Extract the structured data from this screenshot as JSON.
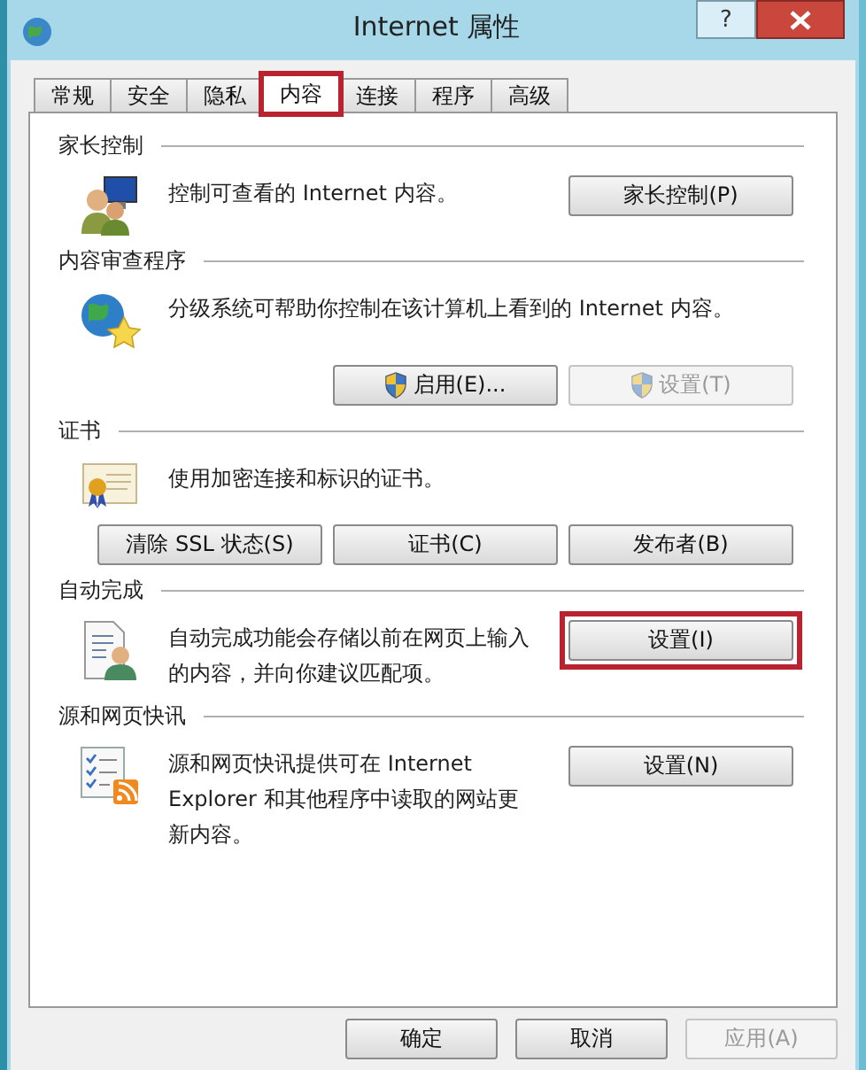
{
  "window": {
    "title": "Internet 属性",
    "help": "?"
  },
  "tabs": [
    {
      "label": "常规",
      "selected": false,
      "highlighted": false
    },
    {
      "label": "安全",
      "selected": false,
      "highlighted": false
    },
    {
      "label": "隐私",
      "selected": false,
      "highlighted": false
    },
    {
      "label": "内容",
      "selected": true,
      "highlighted": true
    },
    {
      "label": "连接",
      "selected": false,
      "highlighted": false
    },
    {
      "label": "程序",
      "selected": false,
      "highlighted": false
    },
    {
      "label": "高级",
      "selected": false,
      "highlighted": false
    }
  ],
  "sections": [
    {
      "title": "家长控制",
      "kind": "side",
      "description": "控制可查看的 Internet 内容。",
      "buttons": [
        {
          "label": "家长控制(P)",
          "disabled": false,
          "shield": false,
          "highlighted": false
        }
      ]
    },
    {
      "title": "内容审查程序",
      "kind": "below",
      "description": "分级系统可帮助你控制在该计算机上看到的 Internet 内容。",
      "buttons": [
        {
          "label": "启用(E)...",
          "disabled": false,
          "shield": true,
          "highlighted": false
        },
        {
          "label": "设置(T)",
          "disabled": true,
          "shield": true,
          "highlighted": false
        }
      ]
    },
    {
      "title": "证书",
      "kind": "below",
      "description": "使用加密连接和标识的证书。",
      "buttons": [
        {
          "label": "清除 SSL 状态(S)",
          "disabled": false,
          "shield": false,
          "highlighted": false
        },
        {
          "label": "证书(C)",
          "disabled": false,
          "shield": false,
          "highlighted": false
        },
        {
          "label": "发布者(B)",
          "disabled": false,
          "shield": false,
          "highlighted": false
        }
      ]
    },
    {
      "title": "自动完成",
      "kind": "side",
      "description": "自动完成功能会存储以前在网页上输入的内容，并向你建议匹配项。",
      "buttons": [
        {
          "label": "设置(I)",
          "disabled": false,
          "shield": false,
          "highlighted": true
        }
      ]
    },
    {
      "title": "源和网页快讯",
      "kind": "side",
      "description": "源和网页快讯提供可在 Internet Explorer 和其他程序中读取的网站更新内容。",
      "buttons": [
        {
          "label": "设置(N)",
          "disabled": false,
          "shield": false,
          "highlighted": false
        }
      ]
    }
  ],
  "footer_buttons": [
    {
      "label": "确定",
      "disabled": false
    },
    {
      "label": "取消",
      "disabled": false
    },
    {
      "label": "应用(A)",
      "disabled": true
    }
  ]
}
